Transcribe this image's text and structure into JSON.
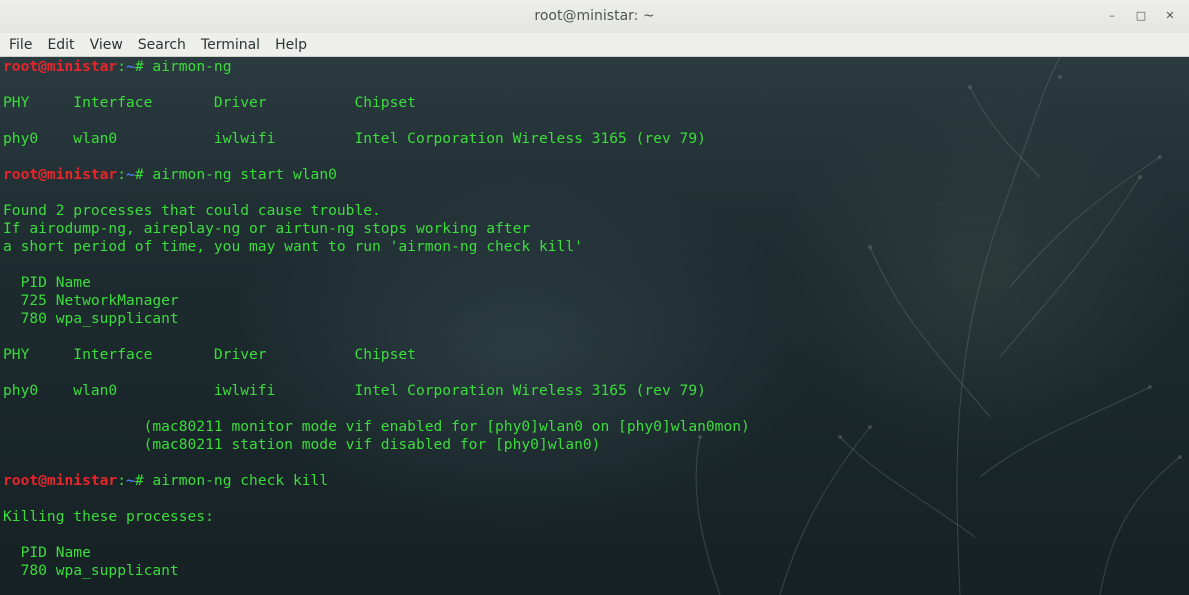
{
  "window": {
    "title": "root@ministar: ~",
    "controls": {
      "minimize": "–",
      "maximize": "□",
      "close": "✕"
    }
  },
  "menu": [
    "File",
    "Edit",
    "View",
    "Search",
    "Terminal",
    "Help"
  ],
  "prompt": {
    "user_host": "root@ministar",
    "sep": ":",
    "path": "~",
    "symbol": "# "
  },
  "colors": {
    "prompt_user": "#e8252a",
    "prompt_path": "#4a7de8",
    "output": "#3cdc3c"
  },
  "terminal_lines": [
    {
      "type": "cmd",
      "text": "airmon-ng"
    },
    {
      "type": "out",
      "text": ""
    },
    {
      "type": "out",
      "text": "PHY     Interface       Driver          Chipset"
    },
    {
      "type": "out",
      "text": ""
    },
    {
      "type": "out",
      "text": "phy0    wlan0           iwlwifi         Intel Corporation Wireless 3165 (rev 79)"
    },
    {
      "type": "out",
      "text": ""
    },
    {
      "type": "cmd",
      "text": "airmon-ng start wlan0"
    },
    {
      "type": "out",
      "text": ""
    },
    {
      "type": "out",
      "text": "Found 2 processes that could cause trouble."
    },
    {
      "type": "out",
      "text": "If airodump-ng, aireplay-ng or airtun-ng stops working after"
    },
    {
      "type": "out",
      "text": "a short period of time, you may want to run 'airmon-ng check kill'"
    },
    {
      "type": "out",
      "text": ""
    },
    {
      "type": "out",
      "text": "  PID Name"
    },
    {
      "type": "out",
      "text": "  725 NetworkManager"
    },
    {
      "type": "out",
      "text": "  780 wpa_supplicant"
    },
    {
      "type": "out",
      "text": ""
    },
    {
      "type": "out",
      "text": "PHY     Interface       Driver          Chipset"
    },
    {
      "type": "out",
      "text": ""
    },
    {
      "type": "out",
      "text": "phy0    wlan0           iwlwifi         Intel Corporation Wireless 3165 (rev 79)"
    },
    {
      "type": "out",
      "text": ""
    },
    {
      "type": "out",
      "text": "                (mac80211 monitor mode vif enabled for [phy0]wlan0 on [phy0]wlan0mon)"
    },
    {
      "type": "out",
      "text": "                (mac80211 station mode vif disabled for [phy0]wlan0)"
    },
    {
      "type": "out",
      "text": ""
    },
    {
      "type": "cmd",
      "text": "airmon-ng check kill"
    },
    {
      "type": "out",
      "text": ""
    },
    {
      "type": "out",
      "text": "Killing these processes:"
    },
    {
      "type": "out",
      "text": ""
    },
    {
      "type": "out",
      "text": "  PID Name"
    },
    {
      "type": "out",
      "text": "  780 wpa_supplicant"
    }
  ]
}
